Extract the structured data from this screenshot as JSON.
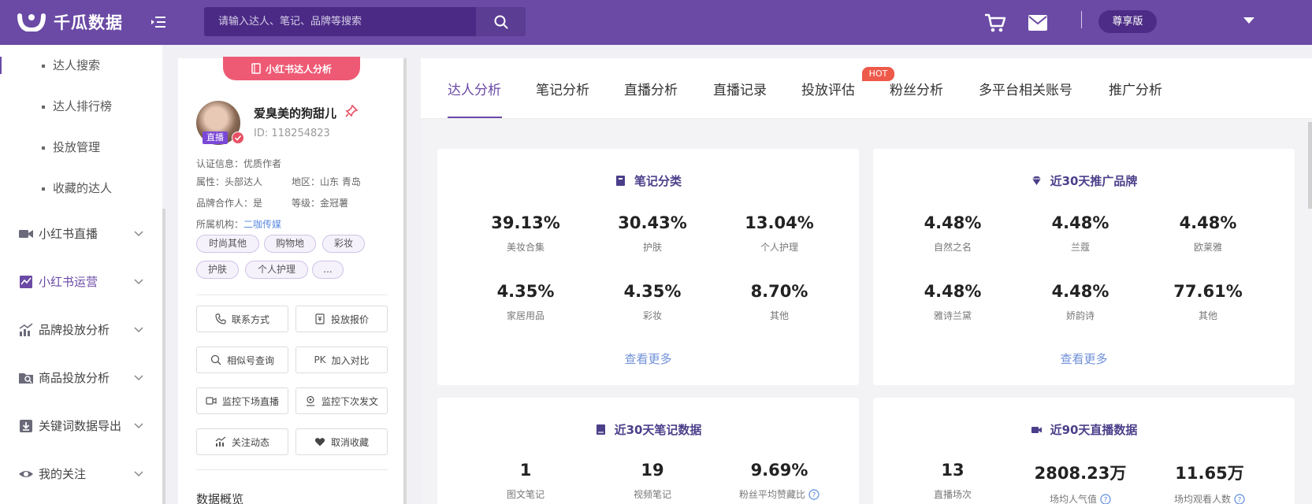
{
  "header": {
    "logo_text": "千瓜数据",
    "search_placeholder": "请输入达人、笔记、品牌等搜索",
    "vip_label": "尊享版"
  },
  "sidebar": {
    "sub_items": [
      {
        "label": "达人搜索"
      },
      {
        "label": "达人排行榜"
      },
      {
        "label": "投放管理"
      },
      {
        "label": "收藏的达人"
      }
    ],
    "items": [
      {
        "label": "小红书直播",
        "icon": "video-camera-icon"
      },
      {
        "label": "小红书运营",
        "icon": "chart-card-icon"
      },
      {
        "label": "品牌投放分析",
        "icon": "bar-chart-icon"
      },
      {
        "label": "商品投放分析",
        "icon": "folder-search-icon"
      },
      {
        "label": "关键词数据导出",
        "icon": "download-icon"
      },
      {
        "label": "我的关注",
        "icon": "eye-icon"
      }
    ]
  },
  "profile": {
    "badge": "小红书达人分析",
    "name": "爱臭美的狗甜儿",
    "id": "ID:  118254823",
    "live": "直播",
    "cert": "认证信息：优质作者",
    "attr": "属性：头部达人",
    "region": "地区：山东 青岛",
    "brand_partner": "品牌合作人：是",
    "level": "等级：金冠薯",
    "org_label": "所属机构：",
    "org_value": "二咖传媒",
    "tags": [
      "时尚其他",
      "购物地",
      "彩妆",
      "护肤",
      "个人护理",
      "..."
    ],
    "actions": [
      "联系方式",
      "投放报价",
      "相似号查询",
      "加入对比",
      "监控下场直播",
      "监控下次发文",
      "关注动态",
      "取消收藏"
    ],
    "pk": "PK",
    "overview": "数据概览"
  },
  "tabs": [
    "达人分析",
    "笔记分析",
    "直播分析",
    "直播记录",
    "投放评估",
    "粉丝分析",
    "多平台相关账号",
    "推广分析"
  ],
  "hot_label": "HOT",
  "cards": {
    "note_category": {
      "title": "笔记分类",
      "stats": [
        {
          "value": "39.13%",
          "label": "美妆合集"
        },
        {
          "value": "30.43%",
          "label": "护肤"
        },
        {
          "value": "13.04%",
          "label": "个人护理"
        },
        {
          "value": "4.35%",
          "label": "家居用品"
        },
        {
          "value": "4.35%",
          "label": "彩妆"
        },
        {
          "value": "8.70%",
          "label": "其他"
        }
      ],
      "more": "查看更多"
    },
    "brands": {
      "title": "近30天推广品牌",
      "stats": [
        {
          "value": "4.48%",
          "label": "自然之名"
        },
        {
          "value": "4.48%",
          "label": "兰蔻"
        },
        {
          "value": "4.48%",
          "label": "欧莱雅"
        },
        {
          "value": "4.48%",
          "label": "雅诗兰黛"
        },
        {
          "value": "4.48%",
          "label": "娇韵诗"
        },
        {
          "value": "77.61%",
          "label": "其他"
        }
      ],
      "more": "查看更多"
    },
    "notes30": {
      "title": "近30天笔记数据",
      "stats": [
        {
          "value": "1",
          "label": "图文笔记"
        },
        {
          "value": "19",
          "label": "视频笔记"
        },
        {
          "value": "9.69%",
          "label": "粉丝平均赞藏比"
        }
      ]
    },
    "live90": {
      "title": "近90天直播数据",
      "stats": [
        {
          "value": "13",
          "label": "直播场次"
        },
        {
          "value": "2808.23万",
          "label": "场均人气值"
        },
        {
          "value": "11.65万",
          "label": "场均观看人数"
        }
      ]
    }
  }
}
